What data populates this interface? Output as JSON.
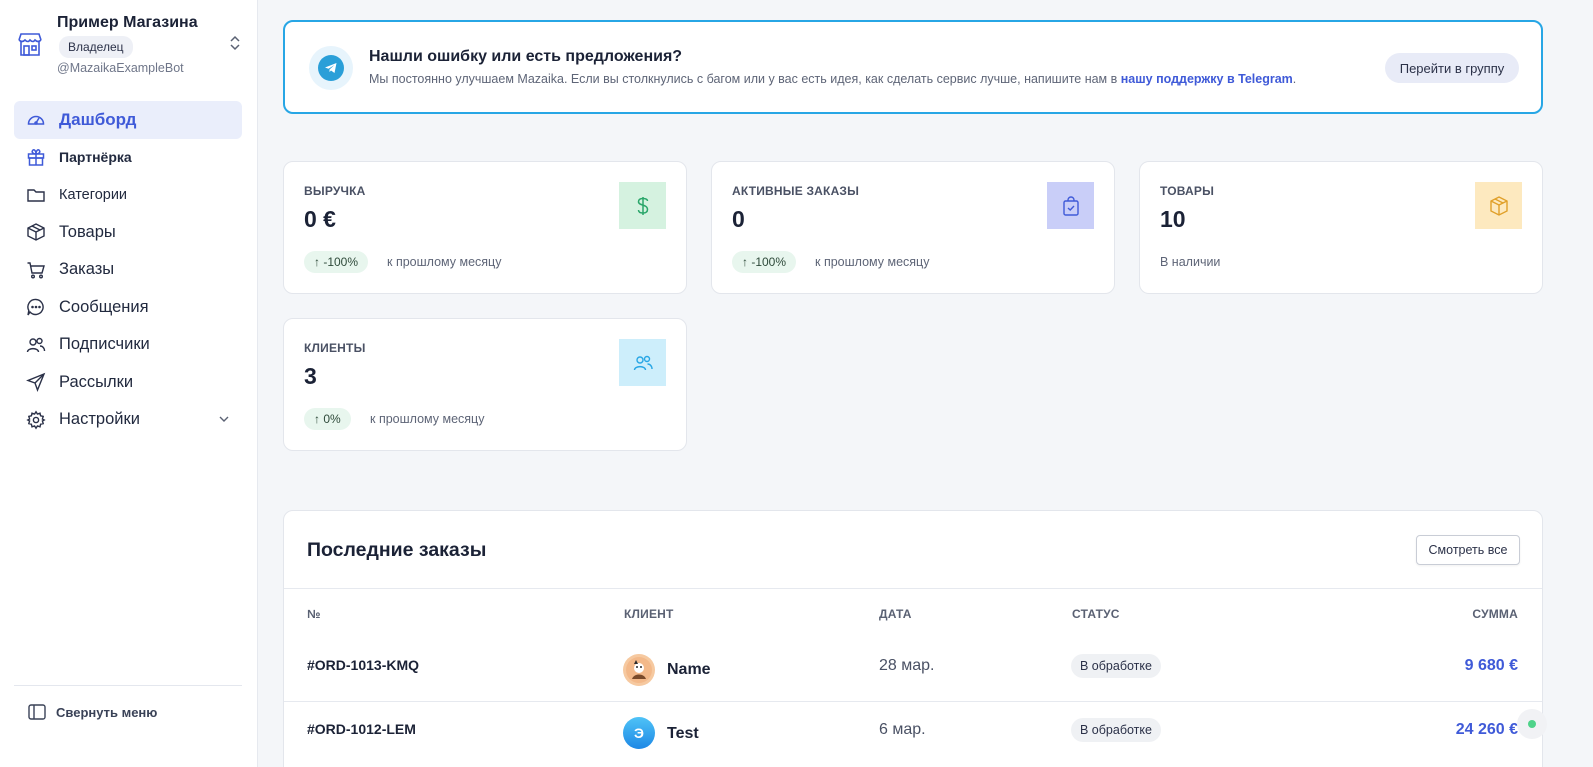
{
  "store": {
    "name": "Пример Магазина",
    "role": "Владелец",
    "bot": "@MazaikaExampleBot"
  },
  "nav": {
    "items": [
      {
        "label": "Дашборд",
        "icon": "gauge-icon"
      },
      {
        "label": "Партнёрка",
        "icon": "gift-icon"
      },
      {
        "label": "Категории",
        "icon": "folder-icon"
      },
      {
        "label": "Товары",
        "icon": "box-icon"
      },
      {
        "label": "Заказы",
        "icon": "cart-icon"
      },
      {
        "label": "Сообщения",
        "icon": "chat-icon"
      },
      {
        "label": "Подписчики",
        "icon": "users-icon"
      },
      {
        "label": "Рассылки",
        "icon": "send-icon"
      },
      {
        "label": "Настройки",
        "icon": "gear-icon"
      }
    ],
    "collapse_label": "Свернуть меню"
  },
  "banner": {
    "title": "Нашли ошибку или есть предложения?",
    "text": "Мы постоянно улучшаем Mazaika. Если вы столкнулись с багом или у вас есть идея, как сделать сервис лучше, напишите нам в",
    "link": "нашу поддержку в Telegram",
    "text_end": ".",
    "button": "Перейти в группу"
  },
  "stats": {
    "revenue": {
      "title": "ВЫРУЧКА",
      "value": "0 €",
      "badge": "↑ -100%",
      "compare": "к прошлому месяцу",
      "icon": "dollar-icon",
      "color": "#d5f2e0"
    },
    "active_orders": {
      "title": "АКТИВНЫЕ ЗАКАЗЫ",
      "value": "0",
      "badge": "↑ -100%",
      "compare": "к прошлому месяцу",
      "icon": "bag-icon",
      "color": "#c9cef8"
    },
    "products": {
      "title": "ТОВАРЫ",
      "value": "10",
      "compare": "В наличии",
      "icon": "cube-icon",
      "color": "#fde9bf"
    },
    "clients": {
      "title": "КЛИЕНТЫ",
      "value": "3",
      "badge": "↑ 0%",
      "compare": "к прошлому месяцу",
      "icon": "users-icon",
      "color": "#cdeefb"
    }
  },
  "orders": {
    "title": "Последние заказы",
    "see_all": "Смотреть все",
    "columns": [
      "№",
      "КЛИЕНТ",
      "ДАТА",
      "СТАТУС",
      "СУММА"
    ],
    "rows": [
      {
        "id": "#ORD-1013-KMQ",
        "client": "Name",
        "date": "28 мар.",
        "status": "В обработке",
        "sum": "9 680 €",
        "avatar": "photo"
      },
      {
        "id": "#ORD-1012-LEM",
        "client": "Test",
        "date": "6 мар.",
        "status": "В обработке",
        "sum": "24 260 €",
        "avatar": "Э"
      }
    ]
  },
  "colors": {
    "accent": "#3f5ad8",
    "telegram": "#2a9fd8",
    "banner_border": "#27a6e5"
  }
}
